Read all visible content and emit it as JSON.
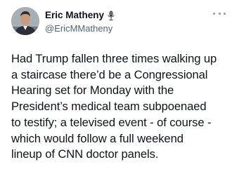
{
  "author": {
    "display_name": "Eric Matheny",
    "handle": "@EricMMatheny",
    "badge_icon": "microphone-icon",
    "avatar": "profile-photo"
  },
  "menu": {
    "icon": "more-options-icon"
  },
  "tweet": {
    "lines": [
      "Had Trump fallen three times walking up",
      "a staircase there’d be a Congressional",
      "Hearing set for Monday with the",
      "President’s medical team subpoenaed",
      "to testify; a televised event - of course -",
      "which would follow a full weekend",
      "lineup of CNN doctor panels."
    ]
  },
  "colors": {
    "text": "#0f1419",
    "secondary_text": "#536471",
    "background": "#ffffff"
  }
}
